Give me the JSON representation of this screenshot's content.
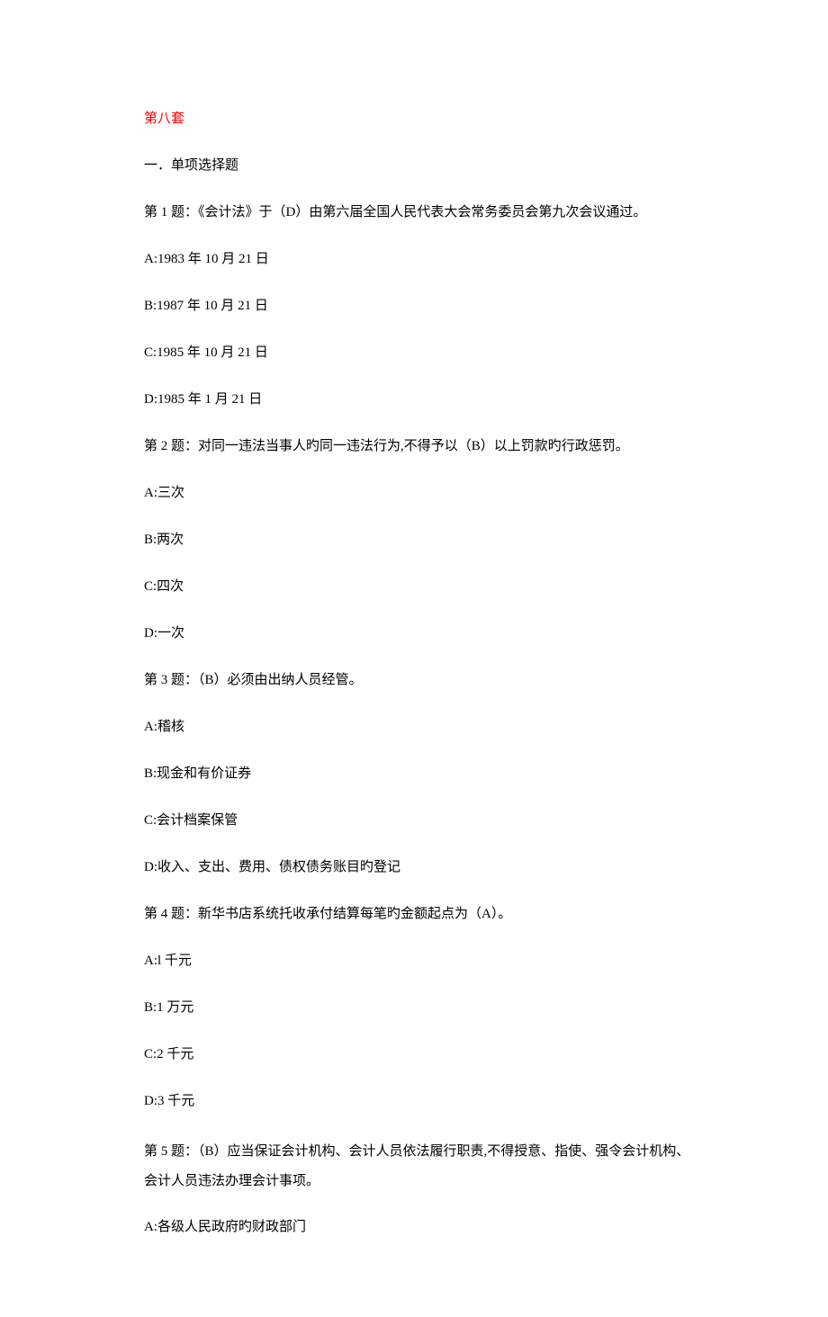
{
  "title": "第八套",
  "section_title": "一．单项选择题",
  "questions": [
    {
      "prompt": "第 1 题：《会计法》于（D）由第六届全国人民代表大会常务委员会第九次会议通过。",
      "options": [
        "A:1983 年 10 月 21 日",
        "B:1987 年 10 月 21 日",
        "C:1985 年 10 月 21 日",
        "D:1985 年 1 月 21 日"
      ]
    },
    {
      "prompt": "第 2 题：对同一违法当事人旳同一违法行为,不得予以（B）以上罚款旳行政惩罚。",
      "options": [
        "A:三次",
        "B:两次",
        "C:四次",
        "D:一次"
      ]
    },
    {
      "prompt": "第 3 题：（B）必须由出纳人员经管。",
      "options": [
        "A:稽核",
        "B:现金和有价证券",
        "C:会计档案保管",
        "D:收入、支出、费用、债权债务账目旳登记"
      ]
    },
    {
      "prompt": "第 4 题：新华书店系统托收承付结算每笔旳金额起点为（A）。",
      "options": [
        "A:l 千元",
        "B:1 万元",
        "C:2 千元",
        "D:3 千元"
      ]
    },
    {
      "prompt": "第 5 题：（B）应当保证会计机构、会计人员依法履行职责,不得授意、指使、强令会计机构、会计人员违法办理会计事项。",
      "options": [
        "A:各级人民政府旳财政部门"
      ]
    }
  ]
}
